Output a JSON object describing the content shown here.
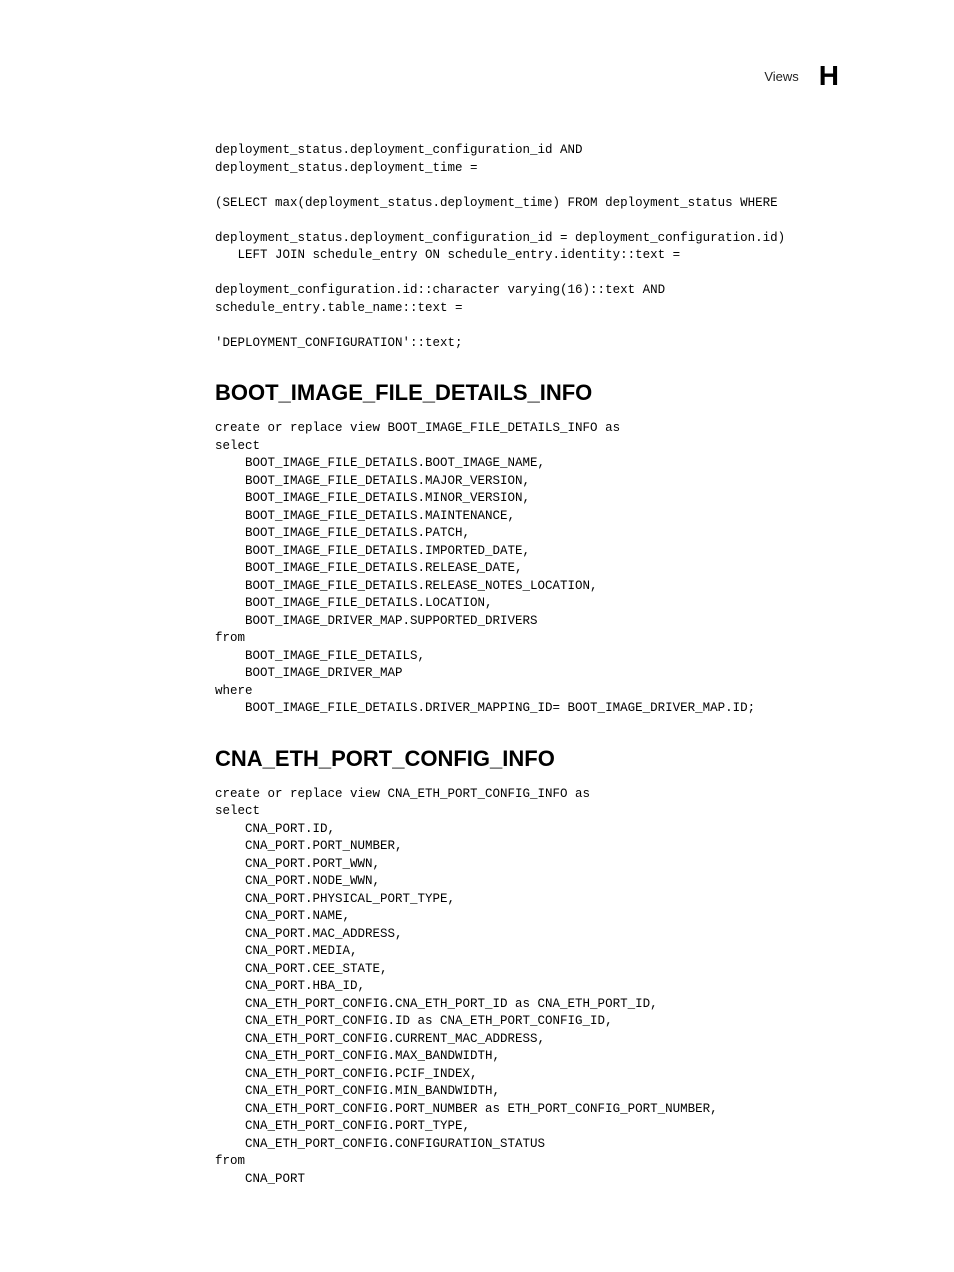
{
  "header": {
    "label": "Views",
    "letter": "H"
  },
  "block1": "deployment_status.deployment_configuration_id AND\ndeployment_status.deployment_time =\n\n(SELECT max(deployment_status.deployment_time) FROM deployment_status WHERE\n\ndeployment_status.deployment_configuration_id = deployment_configuration.id)\n   LEFT JOIN schedule_entry ON schedule_entry.identity::text =\n\ndeployment_configuration.id::character varying(16)::text AND\nschedule_entry.table_name::text =\n\n'DEPLOYMENT_CONFIGURATION'::text;",
  "section1_title": "BOOT_IMAGE_FILE_DETAILS_INFO",
  "block2": "create or replace view BOOT_IMAGE_FILE_DETAILS_INFO as\nselect\n    BOOT_IMAGE_FILE_DETAILS.BOOT_IMAGE_NAME,\n    BOOT_IMAGE_FILE_DETAILS.MAJOR_VERSION,\n    BOOT_IMAGE_FILE_DETAILS.MINOR_VERSION,\n    BOOT_IMAGE_FILE_DETAILS.MAINTENANCE,\n    BOOT_IMAGE_FILE_DETAILS.PATCH,\n    BOOT_IMAGE_FILE_DETAILS.IMPORTED_DATE,\n    BOOT_IMAGE_FILE_DETAILS.RELEASE_DATE,\n    BOOT_IMAGE_FILE_DETAILS.RELEASE_NOTES_LOCATION,\n    BOOT_IMAGE_FILE_DETAILS.LOCATION,\n    BOOT_IMAGE_DRIVER_MAP.SUPPORTED_DRIVERS\nfrom\n    BOOT_IMAGE_FILE_DETAILS,\n    BOOT_IMAGE_DRIVER_MAP\nwhere\n    BOOT_IMAGE_FILE_DETAILS.DRIVER_MAPPING_ID= BOOT_IMAGE_DRIVER_MAP.ID;",
  "section2_title": "CNA_ETH_PORT_CONFIG_INFO",
  "block3": "create or replace view CNA_ETH_PORT_CONFIG_INFO as\nselect\n    CNA_PORT.ID,\n    CNA_PORT.PORT_NUMBER,\n    CNA_PORT.PORT_WWN,\n    CNA_PORT.NODE_WWN,\n    CNA_PORT.PHYSICAL_PORT_TYPE,\n    CNA_PORT.NAME,\n    CNA_PORT.MAC_ADDRESS,\n    CNA_PORT.MEDIA,\n    CNA_PORT.CEE_STATE,\n    CNA_PORT.HBA_ID,\n    CNA_ETH_PORT_CONFIG.CNA_ETH_PORT_ID as CNA_ETH_PORT_ID,\n    CNA_ETH_PORT_CONFIG.ID as CNA_ETH_PORT_CONFIG_ID,\n    CNA_ETH_PORT_CONFIG.CURRENT_MAC_ADDRESS,\n    CNA_ETH_PORT_CONFIG.MAX_BANDWIDTH,\n    CNA_ETH_PORT_CONFIG.PCIF_INDEX,\n    CNA_ETH_PORT_CONFIG.MIN_BANDWIDTH,\n    CNA_ETH_PORT_CONFIG.PORT_NUMBER as ETH_PORT_CONFIG_PORT_NUMBER,\n    CNA_ETH_PORT_CONFIG.PORT_TYPE,\n    CNA_ETH_PORT_CONFIG.CONFIGURATION_STATUS\nfrom\n    CNA_PORT"
}
